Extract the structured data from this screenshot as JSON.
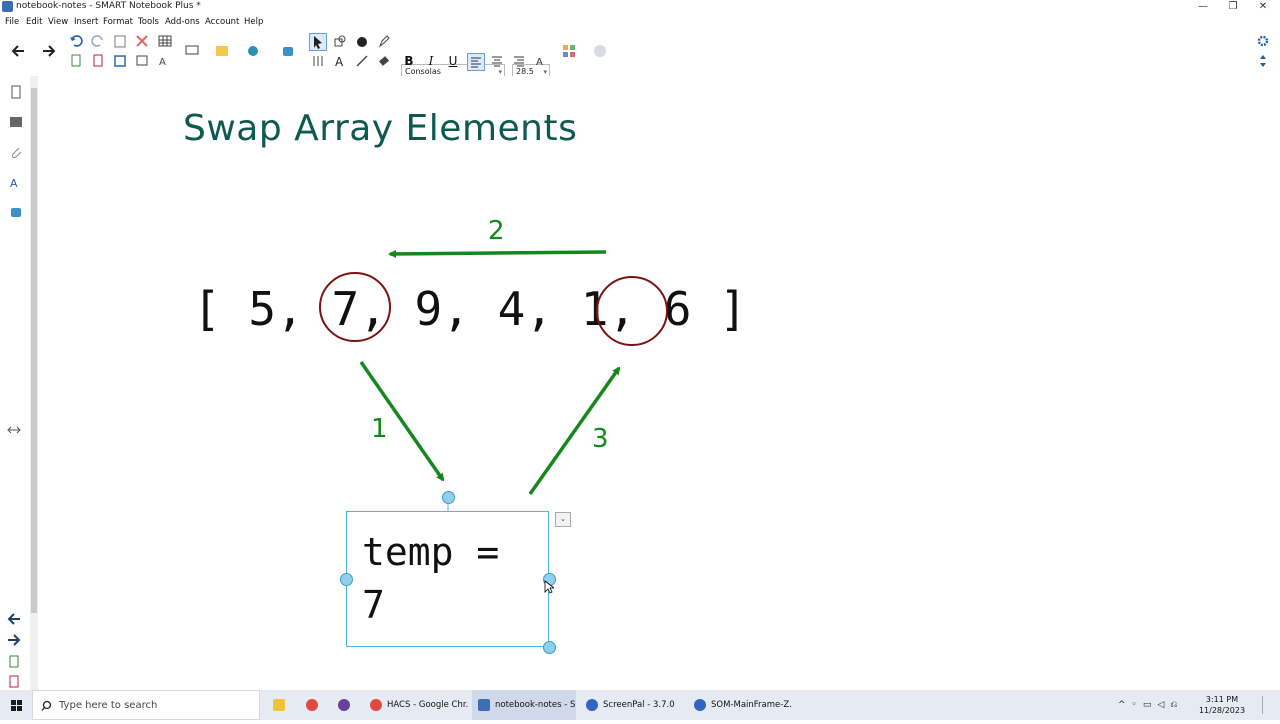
{
  "window": {
    "title": "notebook-notes - SMART Notebook Plus *"
  },
  "menu": [
    "File",
    "Edit",
    "View",
    "Insert",
    "Format",
    "Tools",
    "Add-ons",
    "Account",
    "Help"
  ],
  "toolbar": {
    "font": "Consolas",
    "size": "28.5"
  },
  "page": {
    "title": "Swap Array Elements",
    "array_text": "[ 5, 7, 9, 4, 1, 6 ]",
    "arrow_labels": {
      "one": "1",
      "two": "2",
      "three": "3"
    },
    "temp_line1": "temp =",
    "temp_line2": "7",
    "colors": {
      "title": "#0f5a50",
      "arrows": "#14881e",
      "circles": "#7a1414",
      "selection": "#4fb6d9"
    }
  },
  "taskbar": {
    "search_placeholder": "Type here to search",
    "tasks": [
      "HACS - Google Chr...",
      "notebook-notes - S...",
      "ScreenPal - 3.7.0",
      "SOM-MainFrame-Z..."
    ],
    "time": "3:11 PM",
    "date": "11/28/2023"
  }
}
